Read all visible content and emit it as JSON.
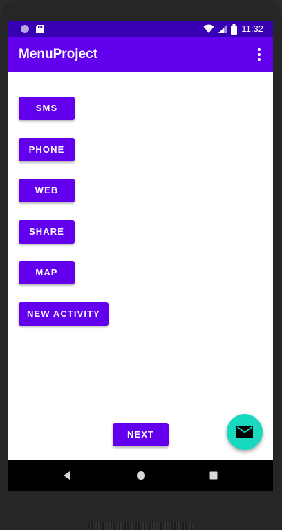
{
  "status_bar": {
    "time": "11:32",
    "icons": [
      "circle-notification-icon",
      "sd-card-icon",
      "wifi-icon",
      "signal-icon",
      "battery-icon"
    ]
  },
  "app_bar": {
    "title": "MenuProject",
    "menu_icon": "more-vert-icon"
  },
  "buttons": {
    "sms": "SMS",
    "phone": "PHONE",
    "web": "WEB",
    "share": "SHARE",
    "map": "MAP",
    "new_activity": "NEW ACTIVITY",
    "next": "NEXT"
  },
  "fab": {
    "icon": "email-icon"
  },
  "colors": {
    "primary": "#6200ee",
    "primary_dark": "#3700b3",
    "accent": "#18d9c0"
  },
  "nav_bar": {
    "icons": [
      "back-icon",
      "home-icon",
      "recents-icon"
    ]
  }
}
